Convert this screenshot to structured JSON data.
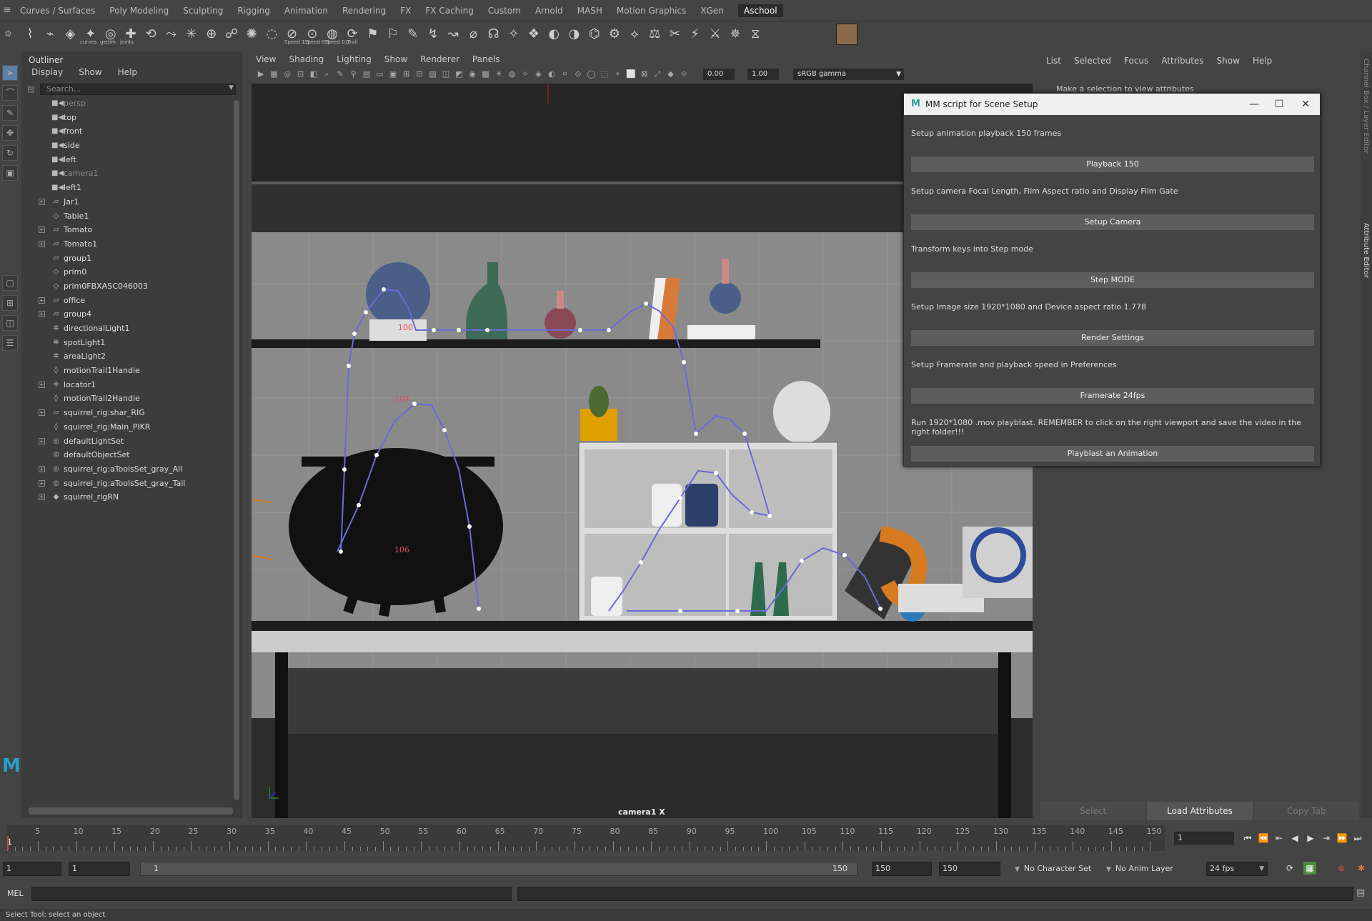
{
  "menubar": {
    "items": [
      "Curves / Surfaces",
      "Poly Modeling",
      "Sculpting",
      "Rigging",
      "Animation",
      "Rendering",
      "FX",
      "FX Caching",
      "Custom",
      "Arnold",
      "MASH",
      "Motion Graphics",
      "XGen",
      "Aschool"
    ],
    "active": "Aschool"
  },
  "shelf": {
    "labels": [
      "curves",
      "gedim",
      "joints",
      "Speed 1.5",
      "Speed 0.5",
      "Speed 0.1",
      "ITrail"
    ]
  },
  "outliner": {
    "title": "Outliner",
    "menu": [
      "Display",
      "Show",
      "Help"
    ],
    "search_placeholder": "Search...",
    "items": [
      {
        "label": "persp",
        "icon": "camera-icon",
        "dim": true,
        "expand": false
      },
      {
        "label": "top",
        "icon": "camera-icon",
        "dim": false,
        "expand": false
      },
      {
        "label": "front",
        "icon": "camera-icon",
        "dim": false,
        "expand": false
      },
      {
        "label": "side",
        "icon": "camera-icon",
        "dim": false,
        "expand": false
      },
      {
        "label": "left",
        "icon": "camera-icon",
        "dim": false,
        "expand": false
      },
      {
        "label": "camera1",
        "icon": "camera-icon",
        "dim": true,
        "expand": false
      },
      {
        "label": "left1",
        "icon": "camera-icon",
        "dim": false,
        "expand": false
      },
      {
        "label": "Jar1",
        "icon": "group-icon",
        "dim": false,
        "expand": true
      },
      {
        "label": "Table1",
        "icon": "mesh-icon",
        "dim": false,
        "expand": false
      },
      {
        "label": "Tomato",
        "icon": "group-icon",
        "dim": false,
        "expand": true
      },
      {
        "label": "Tomato1",
        "icon": "group-icon",
        "dim": false,
        "expand": true
      },
      {
        "label": "group1",
        "icon": "group-icon",
        "dim": false,
        "expand": false
      },
      {
        "label": "prim0",
        "icon": "mesh-icon",
        "dim": false,
        "expand": false
      },
      {
        "label": "prim0FBXASC046003",
        "icon": "mesh-icon",
        "dim": false,
        "expand": false
      },
      {
        "label": "office",
        "icon": "group-icon",
        "dim": false,
        "expand": true
      },
      {
        "label": "group4",
        "icon": "group-icon",
        "dim": false,
        "expand": true
      },
      {
        "label": "directionalLight1",
        "icon": "light-icon",
        "dim": false,
        "expand": false
      },
      {
        "label": "spotLight1",
        "icon": "light-icon",
        "dim": false,
        "expand": false
      },
      {
        "label": "areaLight2",
        "icon": "light-icon",
        "dim": false,
        "expand": false
      },
      {
        "label": "motionTrail1Handle",
        "icon": "trail-icon",
        "dim": false,
        "expand": false
      },
      {
        "label": "locator1",
        "icon": "locator-icon",
        "dim": false,
        "expand": true
      },
      {
        "label": "motionTrail2Handle",
        "icon": "trail-icon",
        "dim": false,
        "expand": false
      },
      {
        "label": "squirrel_rig:shar_RIG",
        "icon": "group-icon",
        "dim": false,
        "expand": true
      },
      {
        "label": "squirrel_rig:Main_PIKR",
        "icon": "trail-icon",
        "dim": false,
        "expand": false
      },
      {
        "label": "defaultLightSet",
        "icon": "set-icon",
        "dim": false,
        "expand": true
      },
      {
        "label": "defaultObjectSet",
        "icon": "set-icon",
        "dim": false,
        "expand": false
      },
      {
        "label": "squirrel_rig:aToolsSet_gray_All",
        "icon": "set-icon",
        "dim": false,
        "expand": true
      },
      {
        "label": "squirrel_rig:aToolsSet_gray_Tail",
        "icon": "set-icon",
        "dim": false,
        "expand": true
      },
      {
        "label": "squirrel_rigRN",
        "icon": "reference-icon",
        "dim": false,
        "expand": true
      }
    ]
  },
  "viewport": {
    "menu": [
      "View",
      "Shading",
      "Lighting",
      "Show",
      "Renderer",
      "Panels"
    ],
    "exposure": "0.00",
    "gamma": "1.00",
    "colorspace": "sRGB gamma",
    "camera_label": "camera1 X",
    "frame_labels": [
      "100",
      "104",
      "106"
    ]
  },
  "attribute_editor": {
    "menu": [
      "List",
      "Selected",
      "Focus",
      "Attributes",
      "Show",
      "Help"
    ],
    "message": "Make a selection to view attributes",
    "bottom_buttons": [
      "Select",
      "Load Attributes",
      "Copy Tab"
    ],
    "side_tabs": [
      "Channel Box / Layer Editor",
      "Attribute Editor"
    ]
  },
  "dialog": {
    "title": "MM script for Scene Setup",
    "sections": [
      {
        "text": "Setup animation playback 150 frames",
        "button": "Playback 150"
      },
      {
        "text": "Setup camera Focal Length, Film Aspect ratio and Display Film Gate",
        "button": "Setup Camera"
      },
      {
        "text": "Transform keys into Step mode",
        "button": "Step MODE"
      },
      {
        "text": "Setup Image size 1920*1080 and Device aspect ratio 1.778",
        "button": "Render Settings"
      },
      {
        "text": "Setup Framerate and playback speed in Preferences",
        "button": "Framerate 24fps"
      },
      {
        "text": "Run 1920*1080 .mov playblast. REMEMBER to click on the right viewport and save the video in the right folder!!!",
        "button": "Playblast an Animation"
      }
    ]
  },
  "timeline": {
    "ticks": [
      "5",
      "10",
      "15",
      "20",
      "25",
      "30",
      "35",
      "40",
      "45",
      "50",
      "55",
      "60",
      "65",
      "70",
      "75",
      "80",
      "85",
      "90",
      "95",
      "100",
      "105",
      "110",
      "115",
      "120",
      "125",
      "130",
      "135",
      "140",
      "145",
      "150"
    ],
    "current_frame_marker": "1",
    "current_frame": "1"
  },
  "range": {
    "start": "1",
    "anim_start": "1",
    "slider_start": "1",
    "slider_end": "150",
    "anim_end": "150",
    "end": "150",
    "character_set": "No Character Set",
    "anim_layer": "No Anim Layer",
    "fps": "24 fps"
  },
  "command": {
    "label": "MEL"
  },
  "status": {
    "text": "Select Tool: select an object"
  },
  "colors": {
    "accent": "#4a90d9",
    "trail": "#6a6ad8",
    "dialog_header": "#f0f0f0"
  }
}
